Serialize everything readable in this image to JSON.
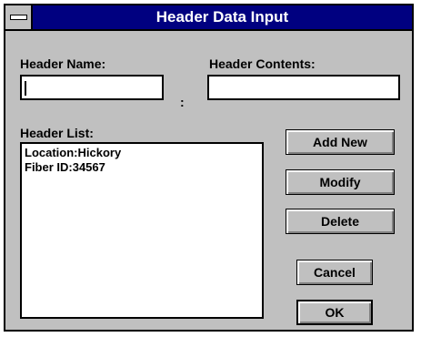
{
  "window": {
    "title": "Header Data Input"
  },
  "form": {
    "header_name_label": "Header Name:",
    "header_name_value": "",
    "header_contents_label": "Header Contents:",
    "header_contents_value": "",
    "separator": ":"
  },
  "header_list": {
    "label": "Header List:",
    "items": [
      "Location:Hickory",
      "Fiber ID:34567"
    ]
  },
  "buttons": {
    "add_new": "Add New",
    "modify": "Modify",
    "delete": "Delete",
    "cancel": "Cancel",
    "ok": "OK"
  }
}
